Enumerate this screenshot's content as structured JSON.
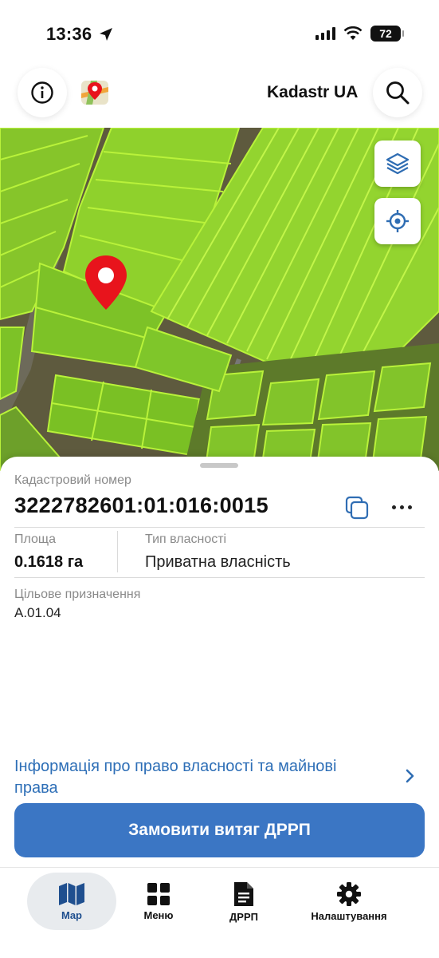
{
  "status_bar": {
    "time": "13:36",
    "battery": "72"
  },
  "header": {
    "title": "Kadastr UA"
  },
  "parcel": {
    "cadastral_label": "Кадастровий номер",
    "cadastral_number": "3222782601:01:016:0015",
    "area_label": "Площа",
    "area_value": "0.1618 га",
    "ownership_label": "Тип власності",
    "ownership_value": "Приватна власність",
    "purpose_label": "Цільове призначення",
    "purpose_value": "А.01.04"
  },
  "rights_link": "Інформація про право власності та майнові права",
  "order_button": "Замовити витяг ДРРП",
  "tabs": [
    {
      "label": "Map",
      "icon": "map-icon",
      "active": true
    },
    {
      "label": "Меню",
      "icon": "grid-icon",
      "active": false
    },
    {
      "label": "ДРРП",
      "icon": "document-icon",
      "active": false
    },
    {
      "label": "Налаштування",
      "icon": "gear-icon",
      "active": false
    }
  ],
  "colors": {
    "accent": "#3b76c4",
    "link": "#2e6fb7",
    "parcel": "#7ccc1c",
    "pin": "#e8141c"
  }
}
